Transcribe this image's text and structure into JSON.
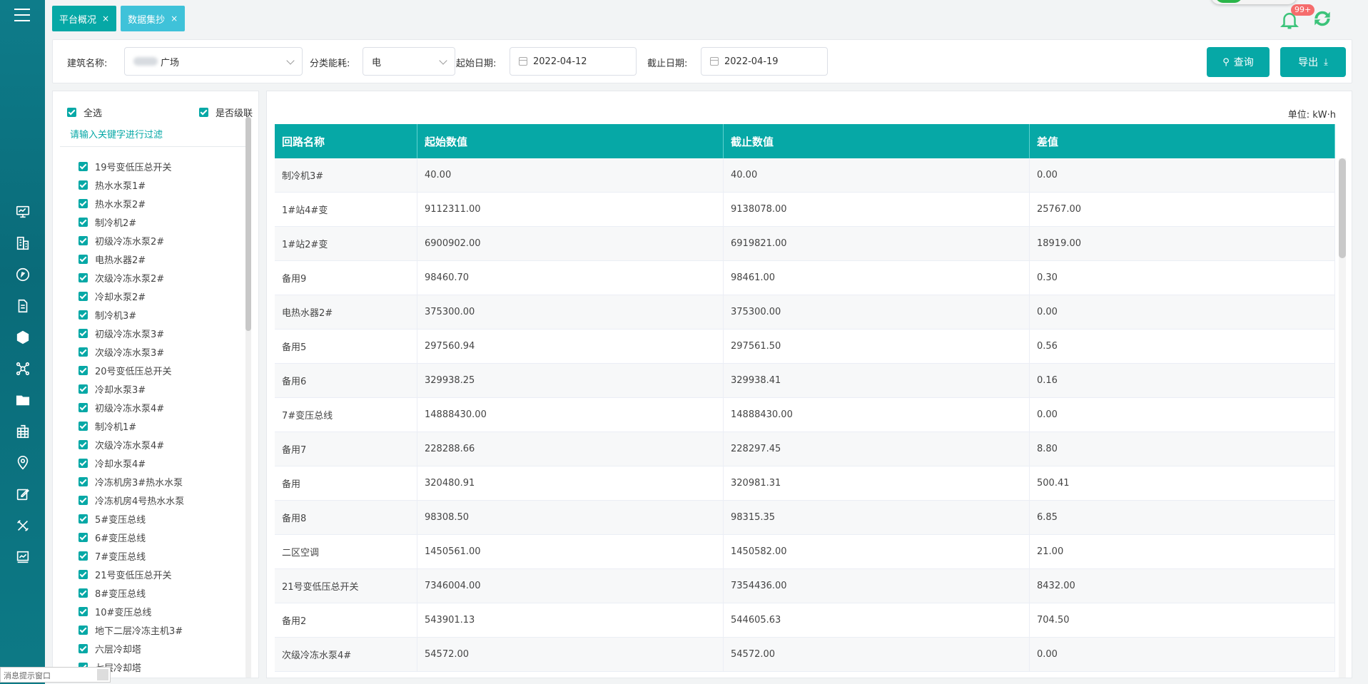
{
  "tabs": [
    {
      "label": "平台概况",
      "close": "×"
    },
    {
      "label": "数据集抄",
      "close": "×"
    }
  ],
  "notifications": {
    "badge": "99+"
  },
  "filters": {
    "building_label": "建筑名称:",
    "building_value": "广场",
    "category_label": "分类能耗:",
    "category_value": "电",
    "start_label": "起始日期:",
    "start_value": "2022-04-12",
    "end_label": "截止日期:",
    "end_value": "2022-04-19",
    "query_button": "查询",
    "export_button": "导出"
  },
  "tree": {
    "select_all": "全选",
    "cascade": "是否级联",
    "filter_placeholder": "请输入关键字进行过滤",
    "items": [
      "19号变低压总开关",
      "热水水泵1#",
      "热水水泵2#",
      "制冷机2#",
      "初级冷冻水泵2#",
      "电热水器2#",
      "次级冷冻水泵2#",
      "冷却水泵2#",
      "制冷机3#",
      "初级冷冻水泵3#",
      "次级冷冻水泵3#",
      "20号变低压总开关",
      "冷却水泵3#",
      "初级冷冻水泵4#",
      "制冷机1#",
      "次级冷冻水泵4#",
      "冷却水泵4#",
      "冷冻机房3#热水水泵",
      "冷冻机房4号热水水泵",
      "5#变压总线",
      "6#变压总线",
      "7#变压总线",
      "21号变低压总开关",
      "8#变压总线",
      "10#变压总线",
      "地下二层冷冻主机3#",
      "六层冷却塔",
      "七层冷却塔"
    ]
  },
  "table": {
    "unit": "单位:  kW·h",
    "headers": [
      "回路名称",
      "起始数值",
      "截止数值",
      "差值"
    ],
    "rows": [
      [
        "制冷机3#",
        "40.00",
        "40.00",
        "0.00"
      ],
      [
        "1#站4#变",
        "9112311.00",
        "9138078.00",
        "25767.00"
      ],
      [
        "1#站2#变",
        "6900902.00",
        "6919821.00",
        "18919.00"
      ],
      [
        "备用9",
        "98460.70",
        "98461.00",
        "0.30"
      ],
      [
        "电热水器2#",
        "375300.00",
        "375300.00",
        "0.00"
      ],
      [
        "备用5",
        "297560.94",
        "297561.50",
        "0.56"
      ],
      [
        "备用6",
        "329938.25",
        "329938.41",
        "0.16"
      ],
      [
        "7#变压总线",
        "14888430.00",
        "14888430.00",
        "0.00"
      ],
      [
        "备用7",
        "228288.66",
        "228297.45",
        "8.80"
      ],
      [
        "备用",
        "320480.91",
        "320981.31",
        "500.41"
      ],
      [
        "备用8",
        "98308.50",
        "98315.35",
        "6.85"
      ],
      [
        "二区空调",
        "1450561.00",
        "1450582.00",
        "21.00"
      ],
      [
        "21号变低压总开关",
        "7346004.00",
        "7354436.00",
        "8432.00"
      ],
      [
        "备用2",
        "543901.13",
        "544605.63",
        "704.50"
      ],
      [
        "次级冷冻水泵4#",
        "54572.00",
        "54572.00",
        "0.00"
      ]
    ]
  },
  "tip_window": {
    "text": "消息提示窗口"
  },
  "colors": {
    "accent": "#06a8a6",
    "tab_secondary": "#3fc2d9",
    "sidebar": "#0a6b79",
    "badge": "#f56c6c"
  }
}
